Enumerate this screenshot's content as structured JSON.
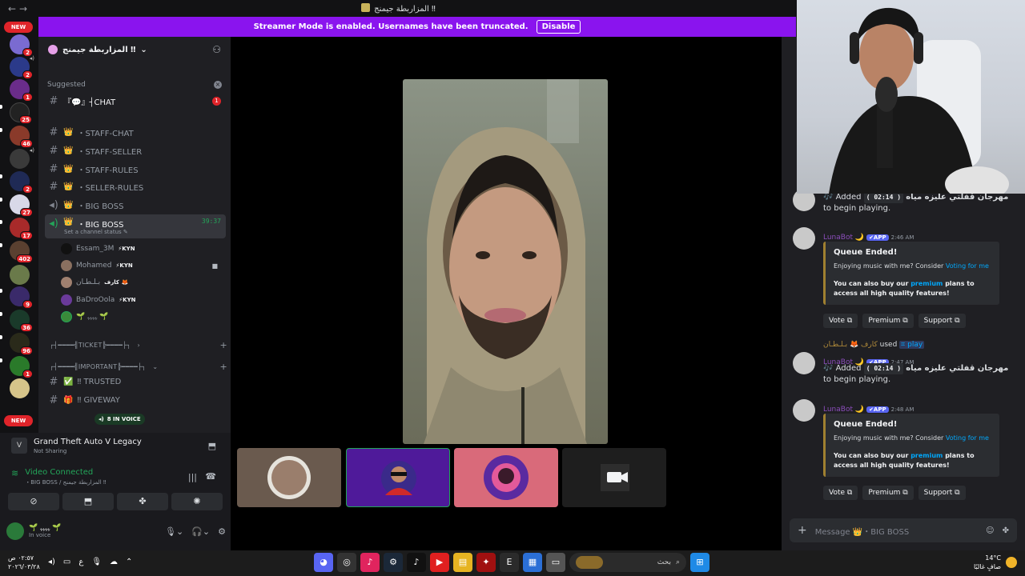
{
  "titlebar": {
    "back": "←",
    "forward": "→",
    "title": "المزاربطة جيمنج ‼"
  },
  "banner": {
    "text": "Streamer Mode is enabled. Usernames have been truncated.",
    "disable": "Disable"
  },
  "rail": {
    "new_top": "NEW",
    "new_bottom": "NEW",
    "badges": [
      "2",
      "1",
      "25",
      "46",
      "2",
      "27",
      "17",
      "402",
      "9",
      "36",
      "96",
      "1"
    ]
  },
  "server": {
    "name": "المزاربطة جيمنج ‼"
  },
  "suggested": {
    "label": "Suggested",
    "channel": "『💬』┤CHAT",
    "ping": "1"
  },
  "channels": [
    {
      "name": "・STAFF-CHAT",
      "emoji": "👑"
    },
    {
      "name": "・STAFF-SELLER",
      "emoji": "👑"
    },
    {
      "name": "・STAFF-RULES",
      "emoji": "👑"
    },
    {
      "name": "・SELLER-RULES",
      "emoji": "👑"
    },
    {
      "name": "・BIG BOSS",
      "emoji": "👑"
    }
  ],
  "active_voice": {
    "name": "・BIG BOSS",
    "emoji": "👑",
    "timer": "39:37",
    "status": "Set a channel status ✎"
  },
  "voice_users": [
    {
      "name": "Essam_3M",
      "tag": "⚡KYN"
    },
    {
      "name": "Mohamed",
      "tag": "⚡KYN",
      "cam": "■"
    },
    {
      "name": "بـلـطـان",
      "tag": "كارف 🦊"
    },
    {
      "name": "BaDroOola",
      "tag": "⚡KYN"
    },
    {
      "name": "🌱 ﮩﮩﮩﮩ 🌱",
      "tag": ""
    }
  ],
  "categories": [
    {
      "name": "┌┤━━━━╣TICKET╠━━━━├┐",
      "arrow": "›"
    },
    {
      "name": "┌┤━━━━╣IMPORTANT╠━━━━├┐",
      "arrow": "⌄"
    }
  ],
  "more_channels": [
    {
      "name": "‼ TRUSTED",
      "emoji": "✅"
    },
    {
      "name": "‼ GIVEWAY",
      "emoji": "🎁"
    }
  ],
  "voice_pill": "8 IN VOICE",
  "activity": {
    "game": "Grand Theft Auto V Legacy",
    "status": "Not Sharing"
  },
  "voice_connection": {
    "title": "Video Connected",
    "sub": "・BIG BOSS / المزاربطة جيمنج ‼"
  },
  "voice_buttons": [
    "⊘",
    "⬒",
    "✤",
    "✺"
  ],
  "me": {
    "name": "🌱 ﮩﮩﮩﮩ 🌱",
    "status": "In voice"
  },
  "chat": {
    "msg1": {
      "text_pre": "🎶 Added",
      "code": "( 02:14 )",
      "song": "مهرجان قفلتي عليزه مياه",
      "text_post": "to begin playing."
    },
    "bot_name": "LunaBot 🌙",
    "app": "✔APP",
    "time2": "2:46 AM",
    "time3": "2:47 AM",
    "time4": "2:48 AM",
    "embed_title": "Queue Ended!",
    "embed_line1_pre": "Enjoying music with me? Consider ",
    "embed_line1_link": "Voting for me",
    "embed_line2_pre": "You can also buy our ",
    "embed_line2_link": "premium",
    "embed_line2_post": " plans to access all high quality features!",
    "btn_vote": "Vote ⧉",
    "btn_premium": "Premium ⧉",
    "btn_support": "Support ⧉",
    "used_user": "كارف 🦊 بـلـطـان",
    "used_word": "used",
    "used_cmd": "⌗ play",
    "placeholder": "Message 👑・BIG BOSS"
  },
  "taskbar": {
    "time": "٠٢:٥٧ ص",
    "date": "٢٠٢٦/٠٣/٢٨",
    "lang": "ع",
    "search": "بحث",
    "temp": "14°C",
    "weather": "صافٍ غالبًا"
  },
  "colors": {
    "accent": "#8a14ee",
    "green": "#23a559",
    "red": "#e0242a",
    "link": "#00a8fc"
  }
}
